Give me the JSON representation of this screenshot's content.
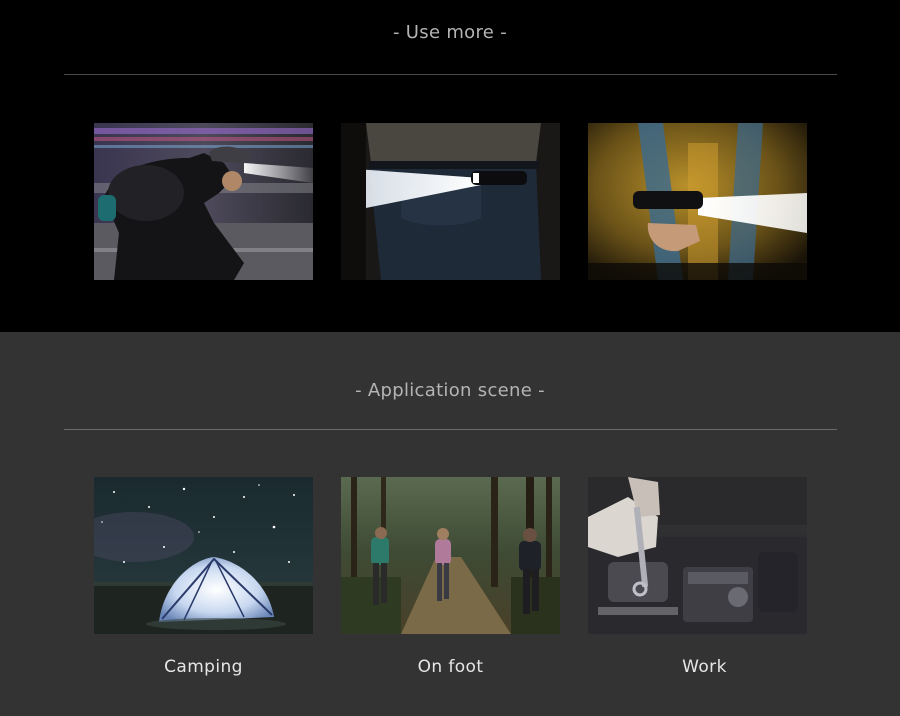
{
  "use_more": {
    "heading": "- Use more -",
    "images": [
      {
        "icon": "cyclist-headlamp-photo"
      },
      {
        "icon": "flashlight-belt-photo"
      },
      {
        "icon": "flashlight-backpack-photo"
      }
    ]
  },
  "application_scene": {
    "heading": "- Application scene -",
    "items": [
      {
        "label": "Camping",
        "icon": "camping-tent-photo"
      },
      {
        "label": "On foot",
        "icon": "hiking-trail-photo"
      },
      {
        "label": "Work",
        "icon": "engine-repair-photo"
      }
    ]
  },
  "colors": {
    "top_background": "#000000",
    "bottom_background": "#333333",
    "heading_text": "#b4b4b4",
    "caption_text": "#e6e6e6",
    "rule_top": "#4a4a4a",
    "rule_bottom": "#6a6a6a"
  }
}
